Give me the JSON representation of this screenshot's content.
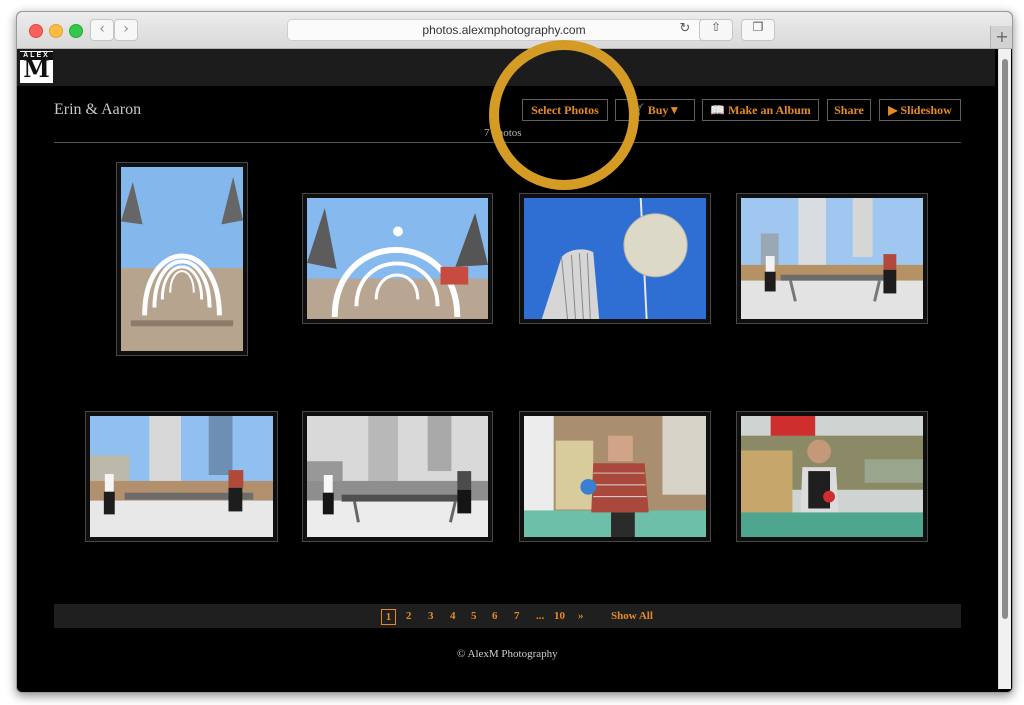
{
  "browser": {
    "url": "photos.alexmphotography.com",
    "back_icon": "chevron-left-icon",
    "forward_icon": "chevron-right-icon",
    "reload_icon": "reload-icon",
    "share_icon": "share-icon",
    "tabs_icon": "tabs-icon",
    "new_tab_label": "+"
  },
  "site": {
    "logo_text": "ALEX",
    "logo_letter": "M",
    "album_title": "Erin & Aaron",
    "photo_count": "7",
    "photo_count_suffix": "photos"
  },
  "actions": {
    "select": "Select Photos",
    "buy": "Buy▼",
    "album": "Make an Album",
    "share": "Share",
    "slideshow": "▶ Slideshow"
  },
  "gallery": {
    "thumbnails": [
      {
        "description": "arches-walkway"
      },
      {
        "description": "arches-trees"
      },
      {
        "description": "sphere-building"
      },
      {
        "description": "pingpong-color"
      },
      {
        "description": "pingpong-wide"
      },
      {
        "description": "pingpong-bw"
      },
      {
        "description": "aaron-pingpong"
      },
      {
        "description": "erin-pingpong"
      }
    ]
  },
  "pagination": {
    "pages": [
      "1",
      "2",
      "3",
      "4",
      "5",
      "6",
      "7",
      "...",
      "10",
      "»"
    ],
    "current": "1",
    "show_all": "Show All"
  },
  "footer": {
    "text": "© AlexM Photography"
  },
  "colors": {
    "accent": "#e48a25",
    "highlight_ring": "#d59c25",
    "background": "#000000"
  }
}
